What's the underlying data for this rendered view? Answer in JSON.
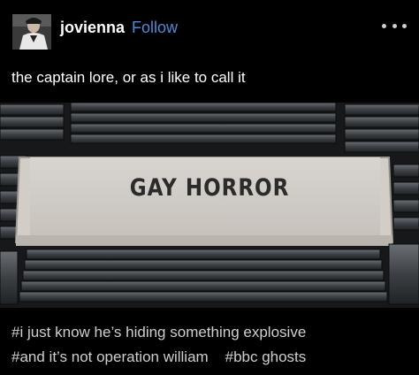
{
  "post": {
    "username": "jovienna",
    "follow_label": "Follow",
    "more_icon": "more-options-icon",
    "caption": "the captain lore, or as i like to call it",
    "photo_sign_text": "GAY HORROR",
    "tags": [
      "#i just know he’s hiding something explosive",
      "#and it’s not operation william",
      "#bbc ghosts"
    ]
  },
  "colors": {
    "background": "#000000",
    "follow_link": "#4c8cd8",
    "tag_text": "#cfcfcf"
  }
}
